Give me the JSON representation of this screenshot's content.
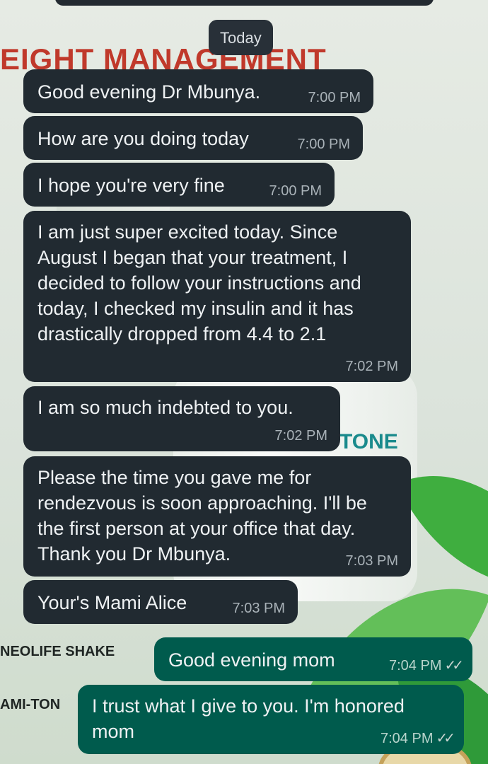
{
  "background": {
    "title_line1": "EIGHT MANAGEMENT",
    "label_shake": "NEOLIFE SHAKE",
    "label_ton": "AMI-TON",
    "brand_tone": "TONE"
  },
  "date_chip": "Today",
  "colors": {
    "incoming_bubble": "#212a31",
    "outgoing_bubble": "#005b4d",
    "date_chip": "#283038"
  },
  "messages": [
    {
      "dir": "in",
      "text": "Good evening Dr Mbunya.",
      "time": "7:00 PM"
    },
    {
      "dir": "in",
      "text": "How are you doing today",
      "time": "7:00 PM"
    },
    {
      "dir": "in",
      "text": "I hope you're very fine",
      "time": "7:00 PM"
    },
    {
      "dir": "in",
      "text": "I am just super excited today. Since August I began that your treatment, I decided to follow your instructions and today, I checked my insulin and it has drastically dropped from 4.4 to 2.1",
      "time": "7:02 PM"
    },
    {
      "dir": "in",
      "text": "I am so much indebted to you.",
      "time": "7:02 PM"
    },
    {
      "dir": "in",
      "text": "Please the time you gave me for rendezvous is soon approaching. I'll be the first person at your office that day. Thank you Dr Mbunya.",
      "time": "7:03 PM"
    },
    {
      "dir": "in",
      "text": "Your's Mami Alice",
      "time": "7:03 PM"
    },
    {
      "dir": "out",
      "text": "Good evening mom",
      "time": "7:04 PM",
      "status": "read-ticks-icon"
    },
    {
      "dir": "out",
      "text": "I trust what I give to you. I'm honored mom",
      "time": "7:04 PM",
      "status": "read-ticks-icon"
    }
  ]
}
